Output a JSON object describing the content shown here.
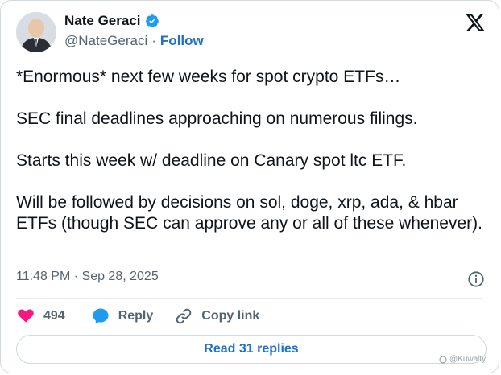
{
  "author": {
    "name": "Nate Geraci",
    "handle": "@NateGeraci",
    "separator": "·",
    "follow_label": "Follow"
  },
  "tweet": {
    "paragraphs": [
      "*Enormous* next few weeks for spot crypto ETFs…",
      "SEC final deadlines approaching on numerous filings.",
      "Starts this week w/ deadline on Canary spot ltc ETF.",
      "Will be followed by decisions on sol, doge, xrp, ada, & hbar ETFs (though SEC can approve any or all of these whenever)."
    ],
    "timestamp": "11:48 PM · Sep 28, 2025"
  },
  "actions": {
    "like_count": "494",
    "reply_label": "Reply",
    "copy_link_label": "Copy link"
  },
  "read_replies_label": "Read 31 replies",
  "watermark": "@Kuwalty",
  "colors": {
    "accent": "#1d70c9",
    "like": "#f91880",
    "reply": "#1d9bf0",
    "text": "#0f1419",
    "muted": "#536471"
  },
  "icons": [
    "verified-badge-icon",
    "x-logo-icon",
    "info-icon",
    "heart-icon",
    "reply-bubble-icon",
    "link-icon"
  ]
}
